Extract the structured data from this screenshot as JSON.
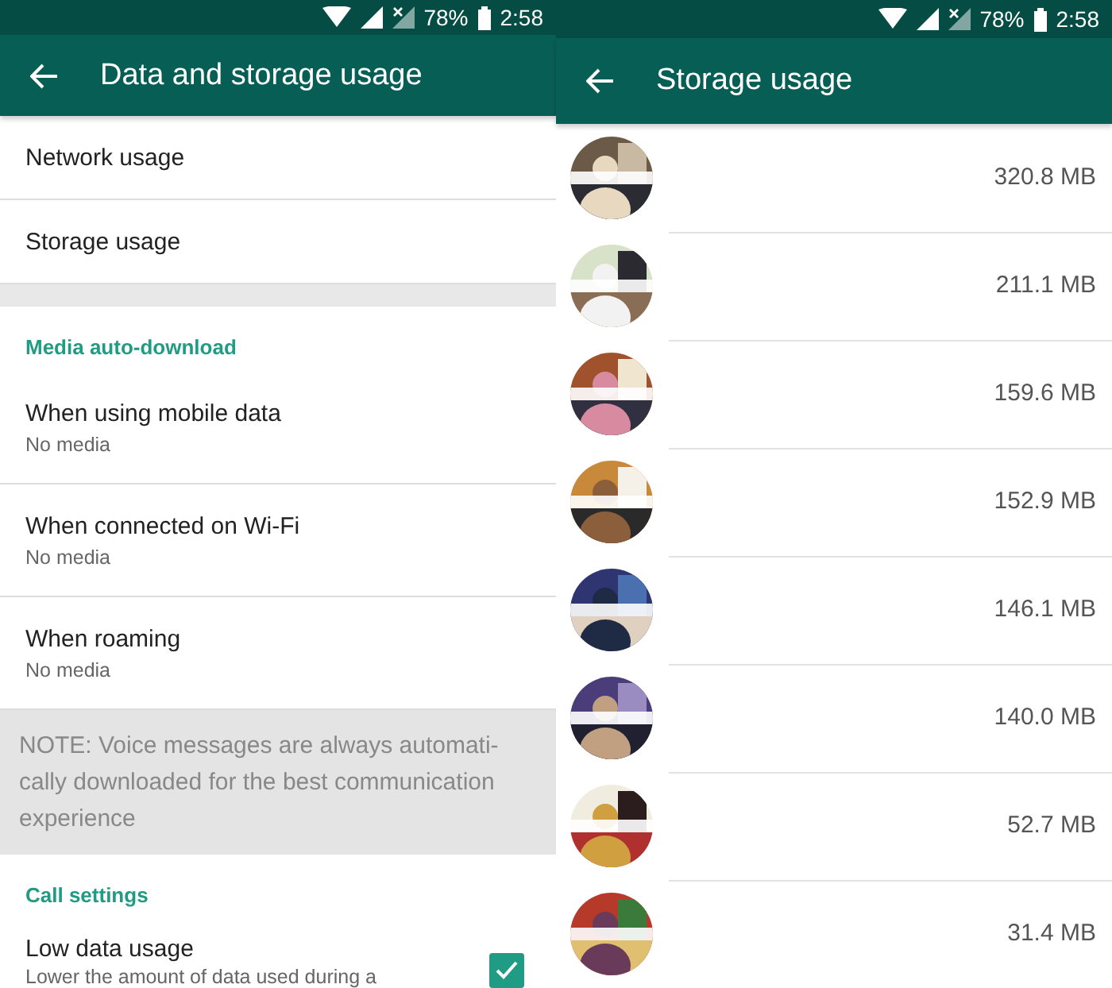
{
  "screens": [
    {
      "status_bar": {
        "battery": "78%",
        "time": "2:58"
      },
      "title": "Data and storage usage",
      "items": [
        {
          "kind": "link",
          "label": "Network usage"
        },
        {
          "kind": "link",
          "label": "Storage usage"
        },
        {
          "kind": "gap"
        },
        {
          "kind": "header",
          "label": "Media auto-download"
        },
        {
          "kind": "setting",
          "label": "When using mobile data",
          "sub": "No media"
        },
        {
          "kind": "setting",
          "label": "When connected on Wi-Fi",
          "sub": "No media"
        },
        {
          "kind": "setting",
          "label": "When roaming",
          "sub": "No media"
        },
        {
          "kind": "note",
          "label": "NOTE: Voice messages are always automati-cally downloaded for the best communication experience"
        },
        {
          "kind": "header",
          "label": "Call settings"
        },
        {
          "kind": "check",
          "label": "Low data usage",
          "sub": "Lower the amount of data used during a",
          "checked": true
        }
      ]
    },
    {
      "status_bar": {
        "battery": "78%",
        "time": "2:58"
      },
      "title": "Storage usage",
      "chats": [
        {
          "kind": "picture",
          "size": "320.8 MB"
        },
        {
          "kind": "picture",
          "size": "211.1 MB"
        },
        {
          "kind": "picture",
          "size": "159.6 MB"
        },
        {
          "kind": "picture",
          "size": "152.9 MB"
        },
        {
          "kind": "picture",
          "size": "146.1 MB"
        },
        {
          "kind": "picture",
          "size": "140.0 MB"
        },
        {
          "kind": "picture",
          "size": "52.7 MB"
        },
        {
          "kind": "picture",
          "size": "31.4 MB"
        }
      ]
    }
  ]
}
